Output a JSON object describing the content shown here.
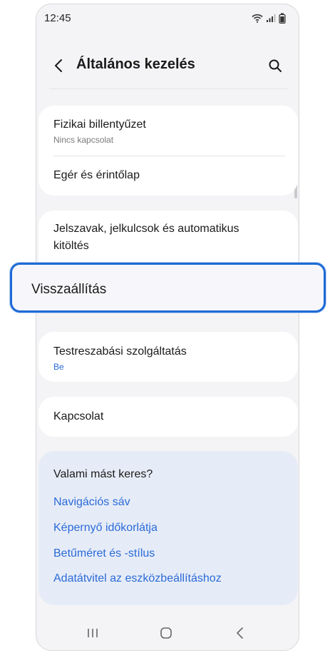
{
  "status_bar": {
    "time": "12:45",
    "icons": [
      "wifi-icon",
      "signal-icon",
      "battery-icon"
    ]
  },
  "header": {
    "title": "Általános kezelés",
    "back_icon": "chevron-left-icon",
    "search_icon": "search-icon"
  },
  "settings": {
    "group1": [
      {
        "title": "Fizikai billentyűzet",
        "subtitle": "Nincs kapcsolat"
      },
      {
        "title": "Egér és érintőlap"
      }
    ],
    "group2": [
      {
        "title_line1": "Jelszavak, jelkulcsok és automatikus",
        "title_line2": "kitöltés"
      }
    ],
    "highlighted": {
      "title": "Visszaállítás"
    },
    "group3": [
      {
        "title": "Testreszabási szolgáltatás",
        "subtitle": "Be"
      }
    ],
    "group4": [
      {
        "title": "Kapcsolat"
      }
    ]
  },
  "suggestions": {
    "title": "Valami mást keres?",
    "links": [
      "Navigációs sáv",
      "Képernyő időkorlátja",
      "Betűméret és -stílus",
      "Adatátvitel az eszközbeállításhoz"
    ]
  },
  "nav_bar": {
    "icons": [
      "recents-icon",
      "home-icon",
      "back-icon"
    ]
  },
  "colors": {
    "accent": "#1e6ad6",
    "link": "#2b6ad8",
    "background": "#f4f4f6",
    "suggest_bg": "#e6ecf7"
  }
}
